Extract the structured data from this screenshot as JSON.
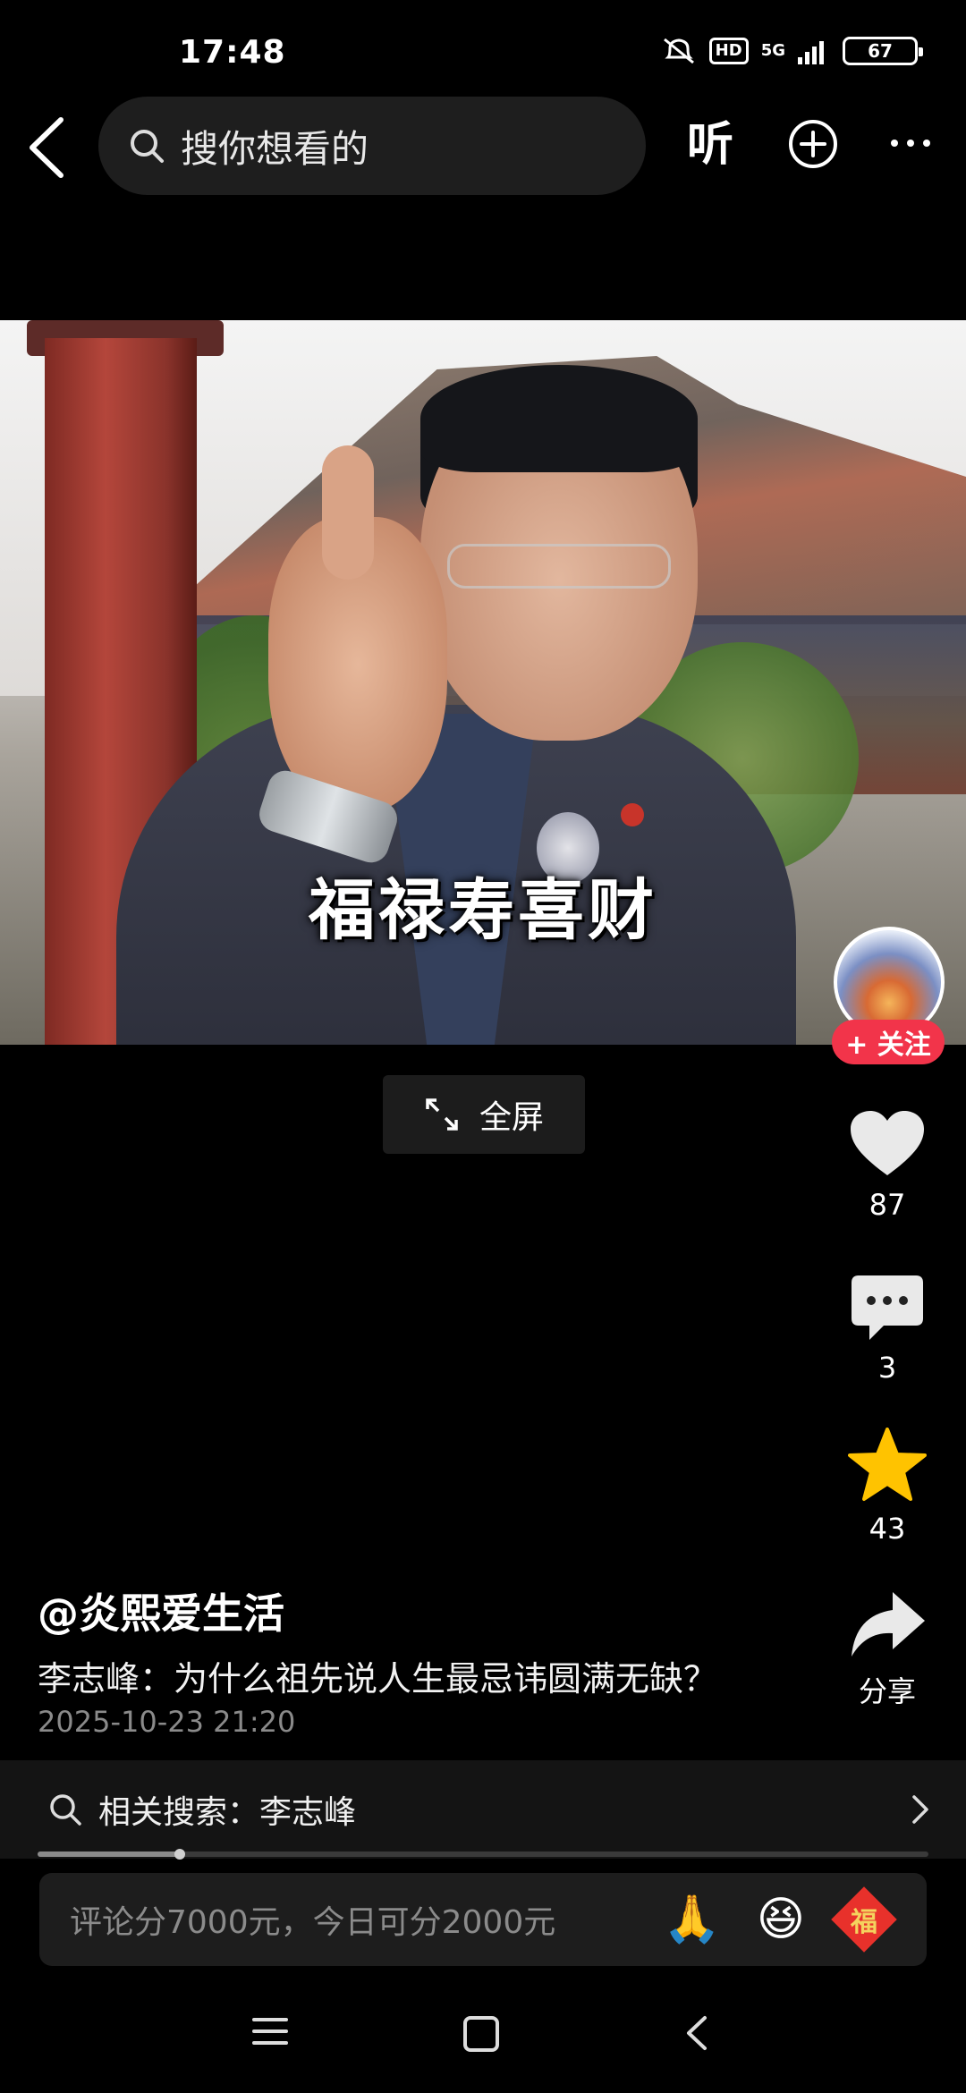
{
  "status_bar": {
    "time": "17:48",
    "hd": "HD",
    "network": "5G",
    "battery": "67"
  },
  "top_bar": {
    "search_placeholder": "搜你想看的",
    "listen_label": "听"
  },
  "video": {
    "caption": "福禄寿喜财",
    "fullscreen_label": "全屏"
  },
  "creator": {
    "follow_label": "+ 关注"
  },
  "actions": {
    "likes": "87",
    "comments": "3",
    "favorites": "43",
    "share_label": "分享"
  },
  "post": {
    "author": "@炎熙爱生活",
    "title": "李志峰：为什么祖先说人生最忌讳圆满无缺？",
    "date": "2025-10-23 21:20"
  },
  "related_search": {
    "label": "相关搜索：李志峰"
  },
  "progress": {
    "fraction": 0.16
  },
  "comment_bar": {
    "placeholder": "评论分7000元，今日可分2000元",
    "emoji_1": "🙏",
    "emoji_2": "😆",
    "fu_char": "福"
  },
  "colors": {
    "accent_red": "#f2344a",
    "star_yellow": "#ffc300"
  }
}
